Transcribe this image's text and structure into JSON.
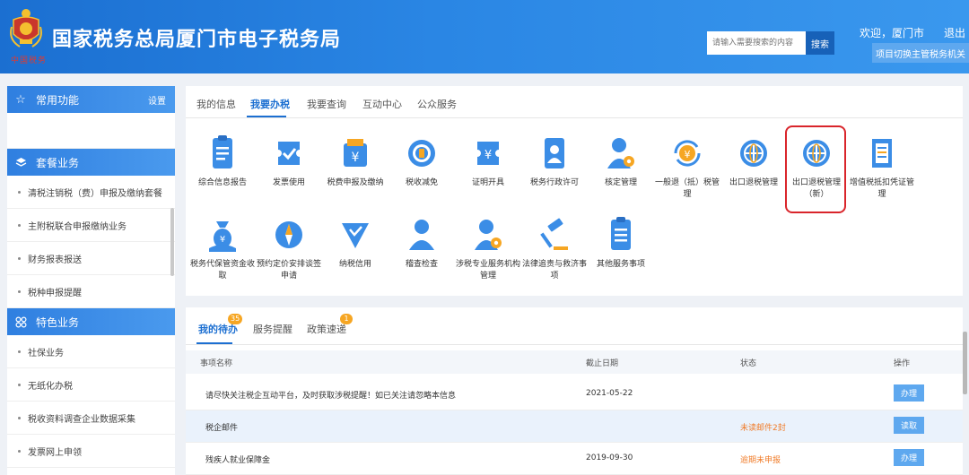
{
  "header": {
    "emblem_caption": "中国税务",
    "title": "国家税务总局厦门市电子税务局",
    "search_placeholder": "请输入需要搜索的内容",
    "search_label": "搜索",
    "welcome": "欢迎，厦门市",
    "logout": "退出",
    "switch_label": "项目切换主管税务机关"
  },
  "sidebar": {
    "sections": [
      {
        "title": "常用功能",
        "icon": "star-icon",
        "setting": "设置",
        "items": []
      },
      {
        "title": "套餐业务",
        "icon": "layers-icon",
        "items": [
          "清税注销税（费）申报及缴纳套餐",
          "主附税联合申报缴纳业务",
          "财务报表报送",
          "税种申报提醒"
        ]
      },
      {
        "title": "特色业务",
        "icon": "grid-icon",
        "items": [
          "社保业务",
          "无纸化办税",
          "税收资料调查企业数据采集",
          "发票网上申领"
        ]
      }
    ]
  },
  "main_tabs": [
    "我的信息",
    "我要办税",
    "我要查询",
    "互动中心",
    "公众服务"
  ],
  "functions": [
    {
      "label": "综合信息报告",
      "icon": "clipboard-icon"
    },
    {
      "label": "发票使用",
      "icon": "ticket-check-icon"
    },
    {
      "label": "税费申报及缴纳",
      "icon": "wallet-yuan-icon"
    },
    {
      "label": "税收减免",
      "icon": "coin-stack-icon"
    },
    {
      "label": "证明开具",
      "icon": "ticket-yuan-icon"
    },
    {
      "label": "税务行政许可",
      "icon": "id-card-icon"
    },
    {
      "label": "核定管理",
      "icon": "user-gear-icon"
    },
    {
      "label": "一般退（抵）税管理",
      "icon": "refund-yuan-icon"
    },
    {
      "label": "出口退税管理",
      "icon": "globe-icon"
    },
    {
      "label": "出口退税管理（新）",
      "icon": "globe-icon"
    },
    {
      "label": "增值税抵扣凭证管理",
      "icon": "receipt-icon"
    },
    {
      "label": "税务代保管资金收取",
      "icon": "money-bag-icon"
    },
    {
      "label": "预约定价安排谈签申请",
      "icon": "compass-icon"
    },
    {
      "label": "纳税信用",
      "icon": "shield-check-icon"
    },
    {
      "label": "稽查检查",
      "icon": "user-icon"
    },
    {
      "label": "涉税专业服务机构管理",
      "icon": "user-gear-icon"
    },
    {
      "label": "法律追责与救济事项",
      "icon": "gavel-icon"
    },
    {
      "label": "其他服务事项",
      "icon": "list-icon"
    }
  ],
  "bottom_tabs": [
    {
      "label": "我的待办",
      "badge": "35"
    },
    {
      "label": "服务提醒",
      "badge": ""
    },
    {
      "label": "政策速递",
      "badge": "1"
    }
  ],
  "table": {
    "headers": [
      "事项名称",
      "截止日期",
      "状态",
      "操作"
    ],
    "rows": [
      {
        "name": "请尽快关注税企互动平台，及时获取涉税提醒！如已关注请忽略本信息",
        "date": "2021-05-22",
        "status": "",
        "action": "办理"
      },
      {
        "name": "税企邮件",
        "date": "",
        "status": "未读邮件2封",
        "action": "读取"
      },
      {
        "name": "残疾人就业保障金",
        "date": "2019-09-30",
        "status": "逾期未申报",
        "action": "办理"
      }
    ]
  },
  "colors": {
    "brand": "#1b6fd1",
    "accent": "#5ea8ef",
    "warn": "#f07b28",
    "highlight": "#d9252b"
  }
}
